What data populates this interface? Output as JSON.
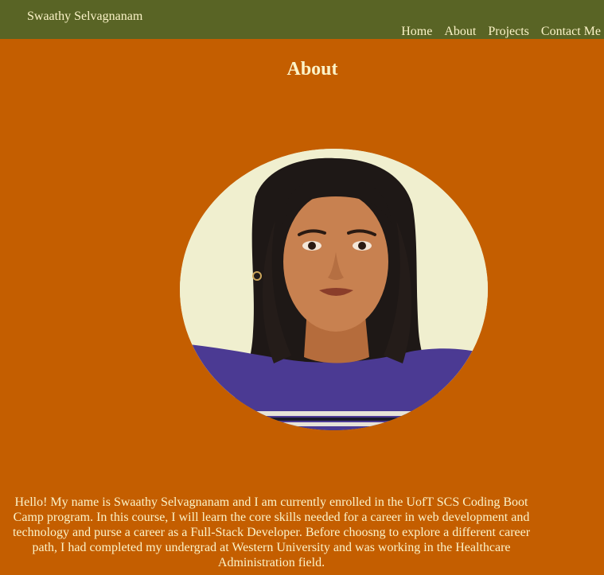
{
  "header": {
    "brand": "Swaathy Selvagnanam",
    "nav": [
      {
        "label": "Home"
      },
      {
        "label": "About"
      },
      {
        "label": "Projects"
      },
      {
        "label": "Contact Me"
      }
    ]
  },
  "main": {
    "title": "About",
    "bio": "Hello! My name is Swaathy Selvagnanam and I am currently enrolled in the UofT SCS Coding Boot Camp program. In this course, I will learn the core skills needed for a career in web development and technology and purse a career as a Full-Stack Developer. Before choosng to explore a different career path, I had completed my undergrad at Western University and was working in the Healthcare Administration field."
  },
  "colors": {
    "page_background": "#c45e00",
    "header_background": "#596425",
    "text": "#fbf3c8"
  }
}
